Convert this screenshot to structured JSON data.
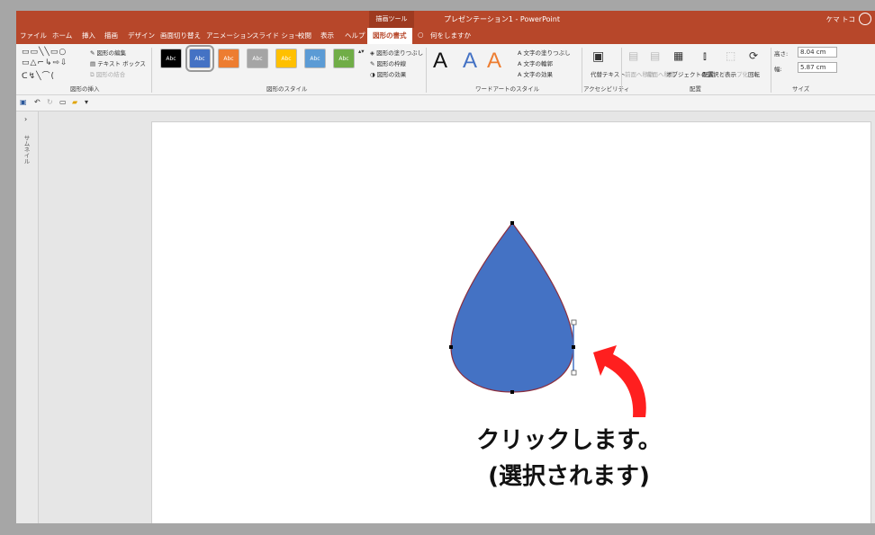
{
  "title_bar": {
    "document_title": "プレゼンテーション1 - PowerPoint",
    "tool_context_label": "描画ツール",
    "user_name": "ケマ トコ"
  },
  "tabs": [
    {
      "label": "ファイル"
    },
    {
      "label": "ホーム"
    },
    {
      "label": "挿入"
    },
    {
      "label": "描画"
    },
    {
      "label": "デザイン"
    },
    {
      "label": "画面切り替え"
    },
    {
      "label": "アニメーション"
    },
    {
      "label": "スライド ショー"
    },
    {
      "label": "校閲"
    },
    {
      "label": "表示"
    },
    {
      "label": "ヘルプ"
    },
    {
      "label": "図形の書式",
      "active": true
    },
    {
      "label": "何をしますか"
    }
  ],
  "ribbon": {
    "insert_shapes": {
      "label": "図形の挿入",
      "edit_shape": "図形の編集",
      "text_box": "テキスト ボックス",
      "merge_shapes": "図形の結合"
    },
    "shape_styles": {
      "label": "図形のスタイル",
      "swatches": [
        {
          "text": "Abc",
          "color": "#000000"
        },
        {
          "text": "Abc",
          "color": "#4472c4"
        },
        {
          "text": "Abc",
          "color": "#ed7d31"
        },
        {
          "text": "Abc",
          "color": "#a5a5a5"
        },
        {
          "text": "Abc",
          "color": "#ffc000"
        },
        {
          "text": "Abc",
          "color": "#5b9bd5"
        },
        {
          "text": "Abc",
          "color": "#70ad47"
        }
      ],
      "fill": "図形の塗りつぶし",
      "outline": "図形の枠線",
      "effects": "図形の効果"
    },
    "wordart": {
      "label": "ワードアートのスタイル",
      "text_fill": "文字の塗りつぶし",
      "text_outline": "文字の輪郭",
      "text_effects": "文字の効果"
    },
    "accessibility": {
      "label": "アクセシビリティ",
      "alt_text": "代替テキスト"
    },
    "arrange": {
      "label": "配置",
      "bring_forward": "前面へ移動",
      "send_backward": "背面へ移動",
      "selection_pane": "オブジェクトの選択と表示",
      "align": "配置",
      "group": "グループ化",
      "rotate": "回転"
    },
    "size": {
      "label": "サイズ",
      "height_label": "高さ:",
      "height_value": "8.04 cm",
      "width_label": "幅:",
      "width_value": "5.87 cm"
    }
  },
  "thumbnails_label": "サムネイル",
  "slide": {
    "shape": {
      "name": "teardrop",
      "fill": "#4472c4",
      "outline": "#8b2d3d"
    },
    "arrow_color": "#ff1f1f"
  },
  "callout": {
    "line1": "クリックします。",
    "line2": "(選択されます)"
  }
}
